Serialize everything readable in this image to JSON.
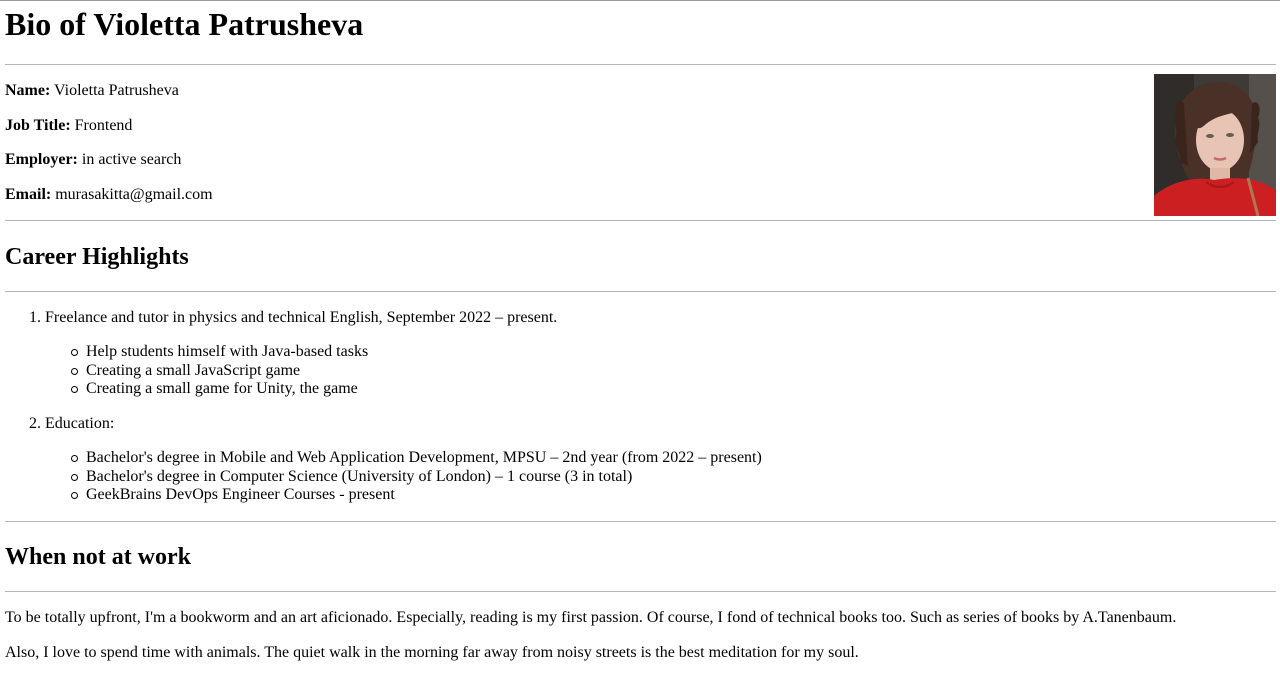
{
  "page": {
    "title": "Bio of Violetta Patrusheva"
  },
  "profile": {
    "name_label": "Name:",
    "name_value": "Violetta Patrusheva",
    "job_label": "Job Title:",
    "job_value": "Frontend",
    "employer_label": "Employer:",
    "employer_value": "in active search",
    "email_label": "Email:",
    "email_value": "murasakitta@gmail.com",
    "photo_colors": {
      "background": "#3e3a37",
      "hair": "#4a3128",
      "skin": "#e8c4b4",
      "shirt": "#cc1f22"
    }
  },
  "career": {
    "heading": "Career Highlights",
    "items": [
      {
        "marker": "1.",
        "text": "Freelance and tutor in physics and technical English, September 2022 – present.",
        "subitems": [
          "Help students himself with Java-based tasks",
          "Creating a small JavaScript game",
          "Creating a small game for Unity, the game"
        ]
      },
      {
        "marker": "2.",
        "text": "Education:",
        "subitems": [
          "Bachelor's degree in Mobile and Web Application Development, MPSU – 2nd year (from 2022 – present)",
          "Bachelor's degree in Computer Science (University of London) – 1 course (3 in total)",
          "GeekBrains DevOps Engineer Courses - present"
        ]
      }
    ]
  },
  "leisure": {
    "heading": "When not at work",
    "paragraphs": [
      "To be totally upfront, I'm a bookworm and an art aficionado. Especially, reading is my first passion. Of course, I fond of technical books too. Such as series of books by A.Tanenbaum.",
      "Also, I love to spend time with animals. The quiet walk in the morning far away from noisy streets is the best meditation for my soul."
    ]
  }
}
